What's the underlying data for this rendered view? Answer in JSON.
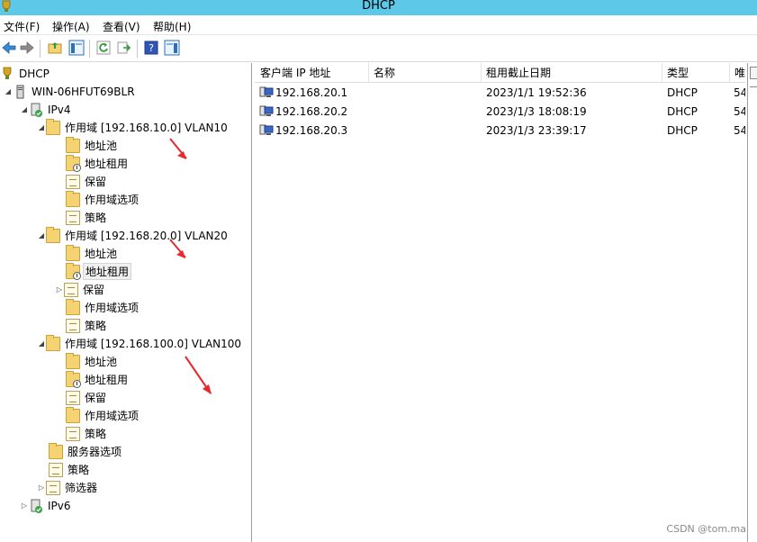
{
  "window": {
    "title": "DHCP"
  },
  "menu": [
    {
      "label": "文件(F)"
    },
    {
      "label": "操作(A)"
    },
    {
      "label": "查看(V)"
    },
    {
      "label": "帮助(H)"
    }
  ],
  "toolbar": {
    "buttons": [
      "back-icon",
      "forward-icon",
      "up-folder-icon",
      "show-hide-tree-icon",
      "refresh-icon",
      "export-list-icon",
      "help-icon",
      "properties-pane-icon"
    ]
  },
  "tree": {
    "root": "DHCP",
    "server": "WIN-06HFUT69BLR",
    "ipv4": "IPv4",
    "scope1": "作用域 [192.168.10.0] VLAN10",
    "scope2": "作用域 [192.168.20.0] VLAN20",
    "scope3": "作用域 [192.168.100.0] VLAN100",
    "address_pool": "地址池",
    "address_leases": "地址租用",
    "reservations": "保留",
    "scope_options": "作用域选项",
    "policies": "策略",
    "server_options": "服务器选项",
    "filters": "筛选器",
    "ipv6": "IPv6"
  },
  "list": {
    "columns": [
      "客户端 IP 地址",
      "名称",
      "租用截止日期",
      "类型",
      "唯"
    ],
    "rows": [
      {
        "ip": "192.168.20.1",
        "name": "",
        "expiry": "2023/1/1 19:52:36",
        "type": "DHCP",
        "extra": "54"
      },
      {
        "ip": "192.168.20.2",
        "name": "",
        "expiry": "2023/1/3 18:08:19",
        "type": "DHCP",
        "extra": "54"
      },
      {
        "ip": "192.168.20.3",
        "name": "",
        "expiry": "2023/1/3 23:39:17",
        "type": "DHCP",
        "extra": "54"
      }
    ]
  },
  "watermark": "CSDN @tom.ma",
  "colors": {
    "titlebar": "#5ec8e8",
    "annotation_arrow": "#e8282d",
    "folder": "#f6d372"
  }
}
